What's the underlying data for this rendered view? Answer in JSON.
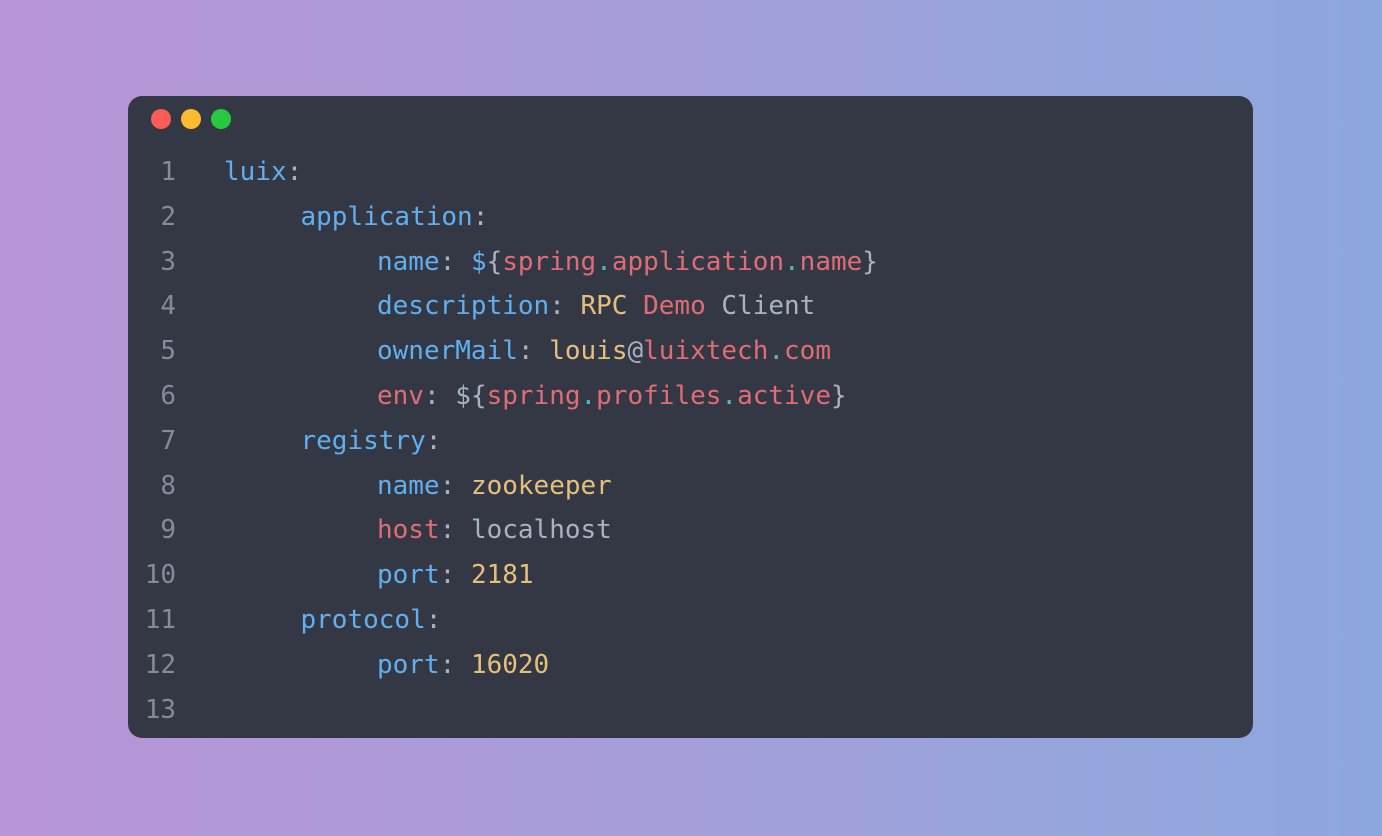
{
  "window": {
    "controls": [
      "close",
      "minimize",
      "zoom"
    ],
    "colors": {
      "close": "#fb5c56",
      "minimize": "#fdbc2e",
      "zoom": "#27c93f",
      "background": "#343844"
    }
  },
  "code": {
    "lines": [
      {
        "number": "1",
        "indent": 0,
        "tokens": [
          {
            "t": "luix",
            "c": "k"
          },
          {
            "t": ":",
            "c": "p"
          }
        ]
      },
      {
        "number": "2",
        "indent": 1,
        "tokens": [
          {
            "t": "application",
            "c": "k"
          },
          {
            "t": ":",
            "c": "p"
          }
        ]
      },
      {
        "number": "3",
        "indent": 2,
        "tokens": [
          {
            "t": "name",
            "c": "k"
          },
          {
            "t": ": ",
            "c": "p"
          },
          {
            "t": "$",
            "c": "k"
          },
          {
            "t": "{",
            "c": "p"
          },
          {
            "t": "spring",
            "c": "r"
          },
          {
            "t": ".",
            "c": "c"
          },
          {
            "t": "application",
            "c": "r"
          },
          {
            "t": ".",
            "c": "c"
          },
          {
            "t": "name",
            "c": "r"
          },
          {
            "t": "}",
            "c": "p"
          }
        ]
      },
      {
        "number": "4",
        "indent": 2,
        "tokens": [
          {
            "t": "description",
            "c": "k"
          },
          {
            "t": ": ",
            "c": "p"
          },
          {
            "t": "RPC",
            "c": "y"
          },
          {
            "t": " ",
            "c": "p"
          },
          {
            "t": "Demo",
            "c": "r"
          },
          {
            "t": " ",
            "c": "p"
          },
          {
            "t": "Client",
            "c": "g"
          }
        ]
      },
      {
        "number": "5",
        "indent": 2,
        "tokens": [
          {
            "t": "ownerMail",
            "c": "k"
          },
          {
            "t": ": ",
            "c": "p"
          },
          {
            "t": "louis",
            "c": "y"
          },
          {
            "t": "@",
            "c": "p"
          },
          {
            "t": "luixtech",
            "c": "r"
          },
          {
            "t": ".",
            "c": "c"
          },
          {
            "t": "com",
            "c": "r"
          }
        ]
      },
      {
        "number": "6",
        "indent": 2,
        "tokens": [
          {
            "t": "env",
            "c": "r"
          },
          {
            "t": ": ",
            "c": "p"
          },
          {
            "t": "$",
            "c": "g"
          },
          {
            "t": "{",
            "c": "p"
          },
          {
            "t": "spring",
            "c": "r"
          },
          {
            "t": ".",
            "c": "c"
          },
          {
            "t": "profiles",
            "c": "r"
          },
          {
            "t": ".",
            "c": "c"
          },
          {
            "t": "active",
            "c": "r"
          },
          {
            "t": "}",
            "c": "p"
          }
        ]
      },
      {
        "number": "7",
        "indent": 1,
        "tokens": [
          {
            "t": "registry",
            "c": "k"
          },
          {
            "t": ":",
            "c": "p"
          }
        ]
      },
      {
        "number": "8",
        "indent": 2,
        "tokens": [
          {
            "t": "name",
            "c": "k"
          },
          {
            "t": ": ",
            "c": "p"
          },
          {
            "t": "zookeeper",
            "c": "y"
          }
        ]
      },
      {
        "number": "9",
        "indent": 2,
        "tokens": [
          {
            "t": "host",
            "c": "r"
          },
          {
            "t": ": ",
            "c": "p"
          },
          {
            "t": "localhost",
            "c": "g"
          }
        ]
      },
      {
        "number": "10",
        "indent": 2,
        "tokens": [
          {
            "t": "port",
            "c": "k"
          },
          {
            "t": ": ",
            "c": "p"
          },
          {
            "t": "2181",
            "c": "y"
          }
        ]
      },
      {
        "number": "11",
        "indent": 1,
        "tokens": [
          {
            "t": "protocol",
            "c": "k"
          },
          {
            "t": ":",
            "c": "p"
          }
        ]
      },
      {
        "number": "12",
        "indent": 2,
        "tokens": [
          {
            "t": "port",
            "c": "k"
          },
          {
            "t": ": ",
            "c": "p"
          },
          {
            "t": "16020",
            "c": "y"
          }
        ]
      },
      {
        "number": "13",
        "indent": 0,
        "tokens": []
      }
    ]
  }
}
